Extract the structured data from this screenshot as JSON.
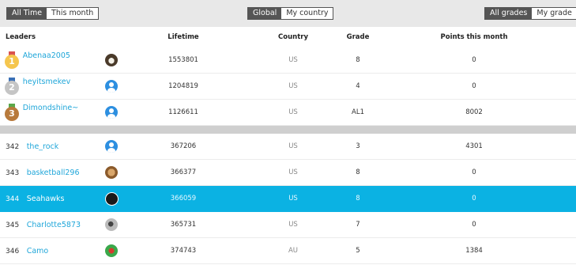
{
  "filters": {
    "time": [
      {
        "label": "All Time",
        "active": true
      },
      {
        "label": "This month",
        "active": false
      }
    ],
    "region": [
      {
        "label": "Global",
        "active": true
      },
      {
        "label": "My country",
        "active": false
      }
    ],
    "grade": [
      {
        "label": "All grades",
        "active": true
      },
      {
        "label": "My grade",
        "active": false
      }
    ]
  },
  "columns": {
    "leaders": "Leaders",
    "lifetime": "Lifetime",
    "country": "Country",
    "grade": "Grade",
    "points": "Points this month"
  },
  "top_leaders": [
    {
      "medal": "1",
      "name": "Abenaa2005",
      "avatar": "dog-avatar",
      "lifetime": "1553801",
      "country": "US",
      "grade": "8",
      "points": "0"
    },
    {
      "medal": "2",
      "name": "heyitsmekev",
      "avatar": "default-avatar",
      "lifetime": "1204819",
      "country": "US",
      "grade": "4",
      "points": "0"
    },
    {
      "medal": "3",
      "name": "Dimondshine~",
      "avatar": "default-avatar",
      "lifetime": "1126611",
      "country": "US",
      "grade": "AL1",
      "points": "8002"
    }
  ],
  "nearby": [
    {
      "rank": "342",
      "name": "the_rock",
      "avatar": "default-avatar",
      "lifetime": "367206",
      "country": "US",
      "grade": "3",
      "points": "4301",
      "highlight": false
    },
    {
      "rank": "343",
      "name": "basketball296",
      "avatar": "basketball-avatar",
      "lifetime": "366377",
      "country": "US",
      "grade": "8",
      "points": "0",
      "highlight": false
    },
    {
      "rank": "344",
      "name": "Seahawks",
      "avatar": "dark-avatar",
      "lifetime": "366059",
      "country": "US",
      "grade": "8",
      "points": "0",
      "highlight": true
    },
    {
      "rank": "345",
      "name": "Charlotte5873",
      "avatar": "bird-avatar",
      "lifetime": "365731",
      "country": "US",
      "grade": "7",
      "points": "0",
      "highlight": false
    },
    {
      "rank": "346",
      "name": "Camo",
      "avatar": "parrot-avatar",
      "lifetime": "374743",
      "country": "AU",
      "grade": "5",
      "points": "1384",
      "highlight": false
    }
  ]
}
